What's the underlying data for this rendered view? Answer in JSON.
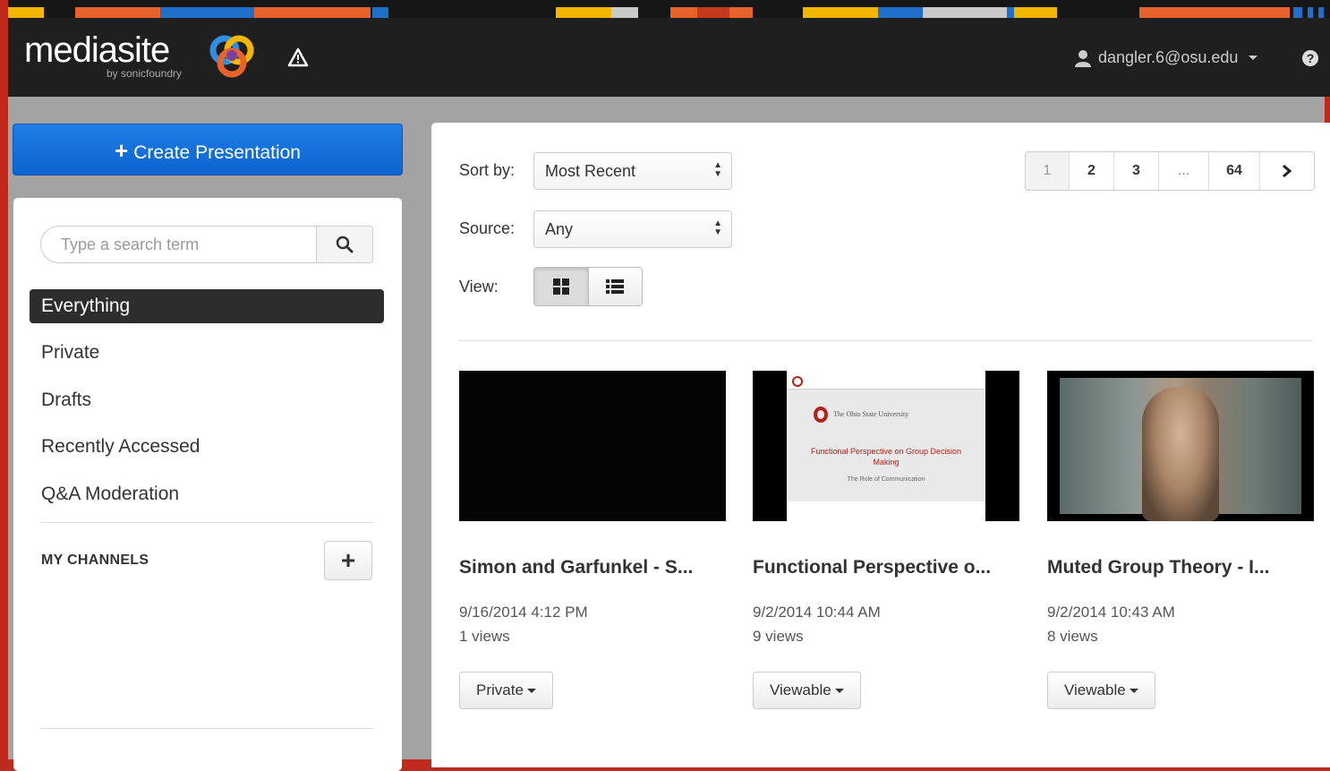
{
  "header": {
    "logo_text": "mediasite",
    "logo_sub": "by sonicfoundry",
    "user": "dangler.6@osu.edu"
  },
  "colors": {
    "accent_blue": "#0c63cf",
    "frame_red": "#bf2a1f",
    "header_dark": "#1f1f1f"
  },
  "sidebar": {
    "create_label": "Create Presentation",
    "search_placeholder": "Type a search term",
    "items": [
      {
        "label": "Everything",
        "active": true
      },
      {
        "label": "Private"
      },
      {
        "label": "Drafts"
      },
      {
        "label": "Recently Accessed"
      },
      {
        "label": "Q&A Moderation"
      }
    ],
    "channels_label": "MY CHANNELS"
  },
  "filters": {
    "sort_label": "Sort by:",
    "sort_value": "Most Recent",
    "source_label": "Source:",
    "source_value": "Any",
    "view_label": "View:"
  },
  "pagination": {
    "pages": [
      "1",
      "2",
      "3",
      "...",
      "64"
    ],
    "current": "1"
  },
  "cards": [
    {
      "title": "Simon and Garfunkel - S...",
      "date": "9/16/2014 4:12 PM",
      "views": "1 views",
      "status": "Private"
    },
    {
      "title": "Functional Perspective o...",
      "date": "9/2/2014 10:44 AM",
      "views": "9 views",
      "status": "Viewable",
      "slide": {
        "university": "The Ohio State University",
        "heading": "Functional Perspective on Group Decision Making",
        "sub": "The Role of Communication"
      }
    },
    {
      "title": "Muted Group Theory - I...",
      "date": "9/2/2014 10:43 AM",
      "views": "8 views",
      "status": "Viewable"
    }
  ]
}
